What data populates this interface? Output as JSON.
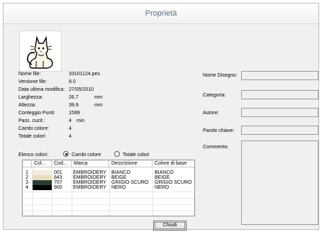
{
  "window": {
    "title": "Proprietà"
  },
  "info": [
    {
      "label": "Nome file:",
      "value": "33101124.pes",
      "unit": ""
    },
    {
      "label": "Versione file:",
      "value": "8.0",
      "unit": ""
    },
    {
      "label": "Data ultima modifica:",
      "value": "27/05/2010",
      "unit": ""
    },
    {
      "label": "Larghezza:",
      "value": "26.7",
      "unit": "mm"
    },
    {
      "label": "Altezza:",
      "value": "39.9",
      "unit": "mm"
    },
    {
      "label": "Conteggio Punti:",
      "value": "1599",
      "unit": ""
    },
    {
      "label": "Pass. cucit.:",
      "value": "4",
      "unit": "min"
    },
    {
      "label": "Cambi colore:",
      "value": "4",
      "unit": ""
    },
    {
      "label": "Totale colori:",
      "value": "4",
      "unit": ""
    }
  ],
  "metadata": {
    "design_name_label": "Nome Disegno:",
    "category_label": "Categoria:",
    "author_label": "Autore:",
    "keywords_label": "Parole chiave:",
    "comment_label": "Commento:"
  },
  "color_list": {
    "label": "Elenco colori:",
    "option_changes": "Cambi colore",
    "option_total": "Totale colori",
    "selected": "Cambi colore",
    "headers": [
      "Col...",
      "Cod...",
      "Marca",
      "Descrizione",
      "Colore di base"
    ],
    "rows": [
      {
        "num": "1",
        "swatch": "#f2ecd8",
        "code": "001",
        "brand": "EMBROIDERY",
        "desc": "BIANCO",
        "base": "BIANCO"
      },
      {
        "num": "2",
        "swatch": "#e8ddb8",
        "code": "843",
        "brand": "EMBROIDERY",
        "desc": "BEIGE",
        "base": "BEIGE"
      },
      {
        "num": "3",
        "swatch": "#2c3a34",
        "code": "707",
        "brand": "EMBROIDERY",
        "desc": "GRIGIO SCURO",
        "base": "GRIGIO SCURO"
      },
      {
        "num": "4",
        "swatch": "#000000",
        "code": "900",
        "brand": "EMBROIDERY",
        "desc": "NERO",
        "base": "NERO"
      }
    ]
  },
  "buttons": {
    "close": "Chiudi"
  },
  "icons": {
    "thumbnail": "cat-embroidery-preview-icon"
  }
}
